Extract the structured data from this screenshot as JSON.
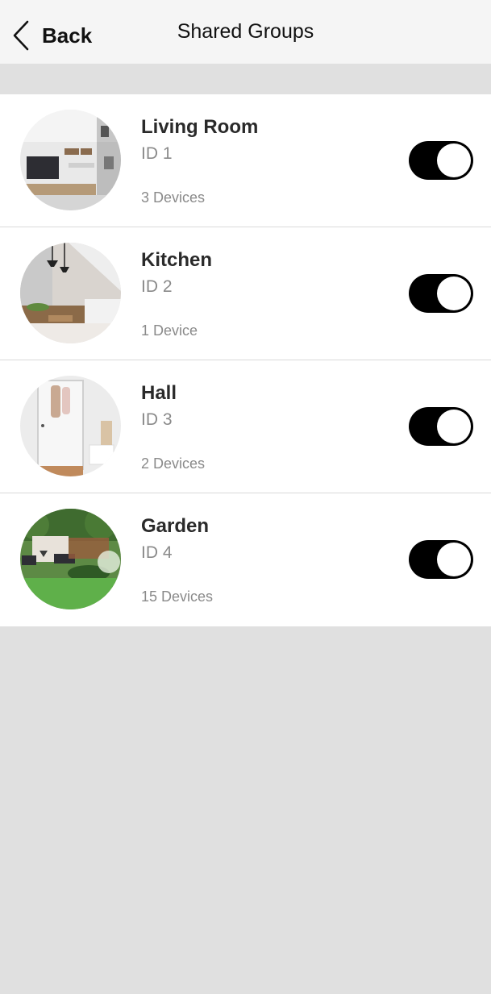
{
  "header": {
    "back_label": "Back",
    "title": "Shared Groups"
  },
  "groups": [
    {
      "name": "Living Room",
      "id_label": "ID 1",
      "devices": "3 Devices",
      "enabled": true,
      "image": "living-room-photo"
    },
    {
      "name": "Kitchen",
      "id_label": "ID 2",
      "devices": "1 Device",
      "enabled": true,
      "image": "kitchen-photo"
    },
    {
      "name": "Hall",
      "id_label": "ID 3",
      "devices": "2 Devices",
      "enabled": true,
      "image": "hall-photo"
    },
    {
      "name": "Garden",
      "id_label": "ID 4",
      "devices": "15 Devices",
      "enabled": true,
      "image": "garden-photo"
    }
  ],
  "colors": {
    "header_bg": "#f5f5f5",
    "page_bg": "#e0e0e0",
    "toggle_on": "#000000",
    "secondary_text": "#8a8a8a"
  }
}
